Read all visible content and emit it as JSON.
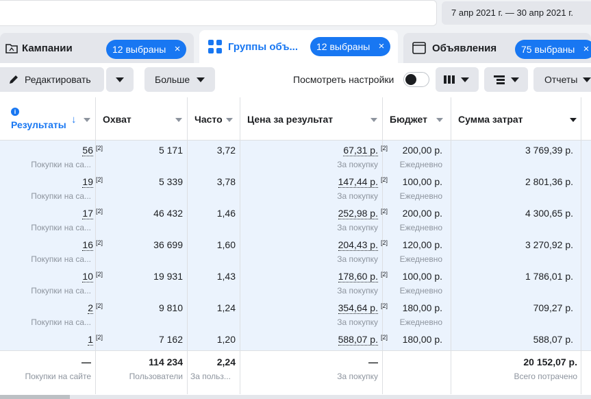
{
  "topbar": {
    "date_range": "7 апр 2021 г. — 30 апр 2021 г."
  },
  "tabs": [
    {
      "label": "Кампании",
      "pill": "12 выбраны",
      "icon": "campaign-folder-icon"
    },
    {
      "label": "Группы объ...",
      "pill": "12 выбраны",
      "icon": "ad-sets-grid-icon"
    },
    {
      "label": "Объявления",
      "pill": "75 выбраны",
      "icon": "ad-window-icon"
    }
  ],
  "pill_close": "×",
  "toolbar": {
    "edit_label": "Редактировать",
    "more_label": "Больше",
    "view_settings_label": "Посмотреть настройки",
    "reports_label": "Отчеты"
  },
  "columns": {
    "results": "Результаты",
    "reach": "Охват",
    "frequency": "Часто",
    "cost_per_result": "Цена за результат",
    "budget": "Бюджет",
    "amount_spent": "Сумма затрат"
  },
  "rows": [
    {
      "results": "56",
      "results_sub": "Покупки на са...",
      "reach": "5 171",
      "frequency": "3,72",
      "cost": "67,31 р.",
      "cost_sub": "За покупку",
      "budget": "200,00 р.",
      "budget_sub": "Ежедневно",
      "spent": "3 769,39 р."
    },
    {
      "results": "19",
      "results_sub": "Покупки на са...",
      "reach": "5 339",
      "frequency": "3,78",
      "cost": "147,44 р.",
      "cost_sub": "За покупку",
      "budget": "100,00 р.",
      "budget_sub": "Ежедневно",
      "spent": "2 801,36 р."
    },
    {
      "results": "17",
      "results_sub": "Покупки на са...",
      "reach": "46 432",
      "frequency": "1,46",
      "cost": "252,98 р.",
      "cost_sub": "За покупку",
      "budget": "200,00 р.",
      "budget_sub": "Ежедневно",
      "spent": "4 300,65 р."
    },
    {
      "results": "16",
      "results_sub": "Покупки на са...",
      "reach": "36 699",
      "frequency": "1,60",
      "cost": "204,43 р.",
      "cost_sub": "За покупку",
      "budget": "120,00 р.",
      "budget_sub": "Ежедневно",
      "spent": "3 270,92 р."
    },
    {
      "results": "10",
      "results_sub": "Покупки на са...",
      "reach": "19 931",
      "frequency": "1,43",
      "cost": "178,60 р.",
      "cost_sub": "За покупку",
      "budget": "100,00 р.",
      "budget_sub": "Ежедневно",
      "spent": "1 786,01 р."
    },
    {
      "results": "2",
      "results_sub": "Покупки на са...",
      "reach": "9 810",
      "frequency": "1,24",
      "cost": "354,64 р.",
      "cost_sub": "За покупку",
      "budget": "180,00 р.",
      "budget_sub": "Ежедневно",
      "spent": "709,27 р."
    },
    {
      "results": "1",
      "results_sub": "",
      "reach": "7 162",
      "frequency": "1,20",
      "cost": "588,07 р.",
      "cost_sub": "",
      "budget": "180,00 р.",
      "budget_sub": "",
      "spent": "588,07 р."
    }
  ],
  "sup": "[2]",
  "totals": {
    "results": "—",
    "results_sub": "Покупки на сайте",
    "reach": "114 234",
    "reach_sub": "Пользователи",
    "frequency": "2,24",
    "frequency_sub": "За польз...",
    "cost": "—",
    "cost_sub": "За покупку",
    "spent": "20 152,07 р.",
    "spent_sub": "Всего потрачено"
  },
  "colors": {
    "accent": "#1877f2",
    "row_bg": "#ebf3fd"
  }
}
